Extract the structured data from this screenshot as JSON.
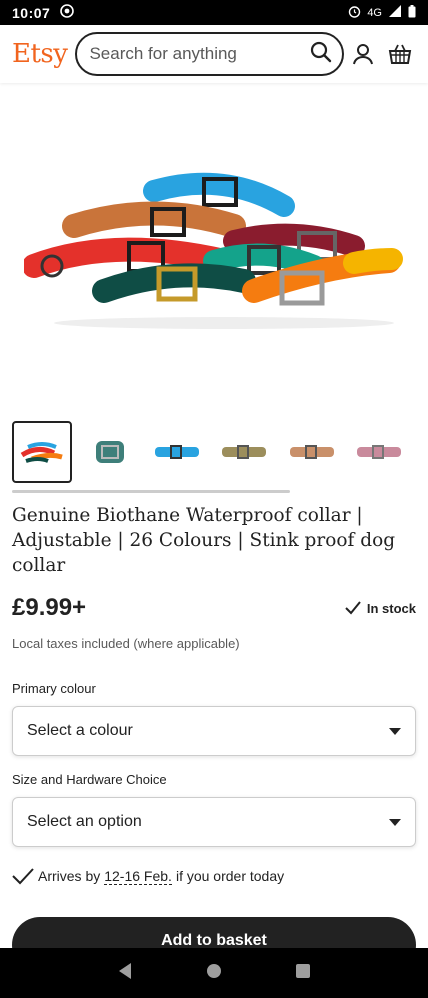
{
  "status_bar": {
    "time": "10:07",
    "network": "4G"
  },
  "header": {
    "logo": "Etsy",
    "search_placeholder": "Search for anything"
  },
  "thumbnails": [
    {
      "name": "thumb-multicolour",
      "active": true
    },
    {
      "name": "thumb-teal"
    },
    {
      "name": "thumb-blue"
    },
    {
      "name": "thumb-khaki"
    },
    {
      "name": "thumb-tan"
    },
    {
      "name": "thumb-pink"
    }
  ],
  "product": {
    "title": "Genuine Biothane Waterproof collar | Adjustable | 26 Colours | Stink proof dog collar",
    "price": "£9.99+",
    "stock": "In stock",
    "taxes": "Local taxes included (where applicable)"
  },
  "options": {
    "primary_colour_label": "Primary colour",
    "primary_colour_value": "Select a colour",
    "size_label": "Size and Hardware Choice",
    "size_value": "Select an option"
  },
  "delivery": {
    "prefix": "Arrives by",
    "dates": "12-16 Feb.",
    "suffix": "if you order today"
  },
  "actions": {
    "add_to_basket": "Add to basket"
  },
  "colors": {
    "brand": "#F1641E",
    "text": "#222222",
    "button": "#222222"
  }
}
